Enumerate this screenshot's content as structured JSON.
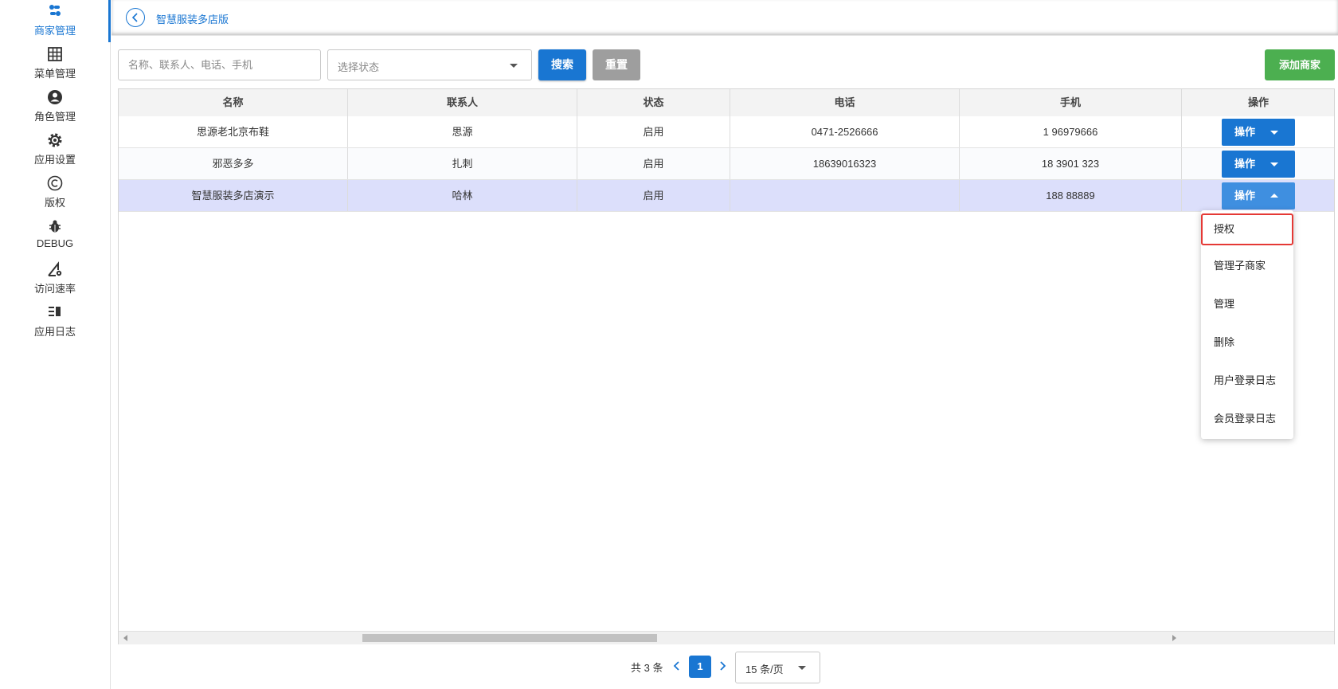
{
  "sidebar": {
    "items": [
      {
        "label": "商家管理",
        "icon": "merchant-icon",
        "active": true
      },
      {
        "label": "菜单管理",
        "icon": "grid-icon"
      },
      {
        "label": "角色管理",
        "icon": "person-icon"
      },
      {
        "label": "应用设置",
        "icon": "gear-icon"
      },
      {
        "label": "版权",
        "icon": "copyright-icon"
      },
      {
        "label": "DEBUG",
        "icon": "bug-icon"
      },
      {
        "label": "访问速率",
        "icon": "speed-settings-icon"
      },
      {
        "label": "应用日志",
        "icon": "log-list-icon"
      }
    ]
  },
  "header": {
    "breadcrumb": "智慧服装多店版"
  },
  "toolbar": {
    "search_placeholder": "名称、联系人、电话、手机",
    "status_placeholder": "选择状态",
    "search_label": "搜索",
    "reset_label": "重置",
    "add_label": "添加商家"
  },
  "table": {
    "columns": [
      "名称",
      "联系人",
      "状态",
      "电话",
      "手机",
      "操作"
    ],
    "rows": [
      {
        "name": "思源老北京布鞋",
        "contact": "思源",
        "status": "启用",
        "phone": "0471-2526666",
        "mobile": "1 96979666",
        "action": "操作"
      },
      {
        "name": "邪恶多多",
        "contact": "扎刺",
        "status": "启用",
        "phone": "18639016323",
        "mobile": "18 3901 323",
        "action": "操作"
      },
      {
        "name": "智慧服装多店演示",
        "contact": "哈林",
        "status": "启用",
        "phone": "",
        "mobile": "188 88889",
        "action": "操作"
      }
    ]
  },
  "menu": {
    "items": [
      "授权",
      "管理子商家",
      "管理",
      "删除",
      "用户登录日志",
      "会员登录日志"
    ]
  },
  "pager": {
    "total": "共 3 条",
    "page": "1",
    "page_size": "15 条/页"
  },
  "colors": {
    "primary": "#1976d2",
    "success": "#4caf50",
    "reset": "#9e9e9e",
    "highlight": "#dcdffb",
    "focus": "#e53935"
  }
}
